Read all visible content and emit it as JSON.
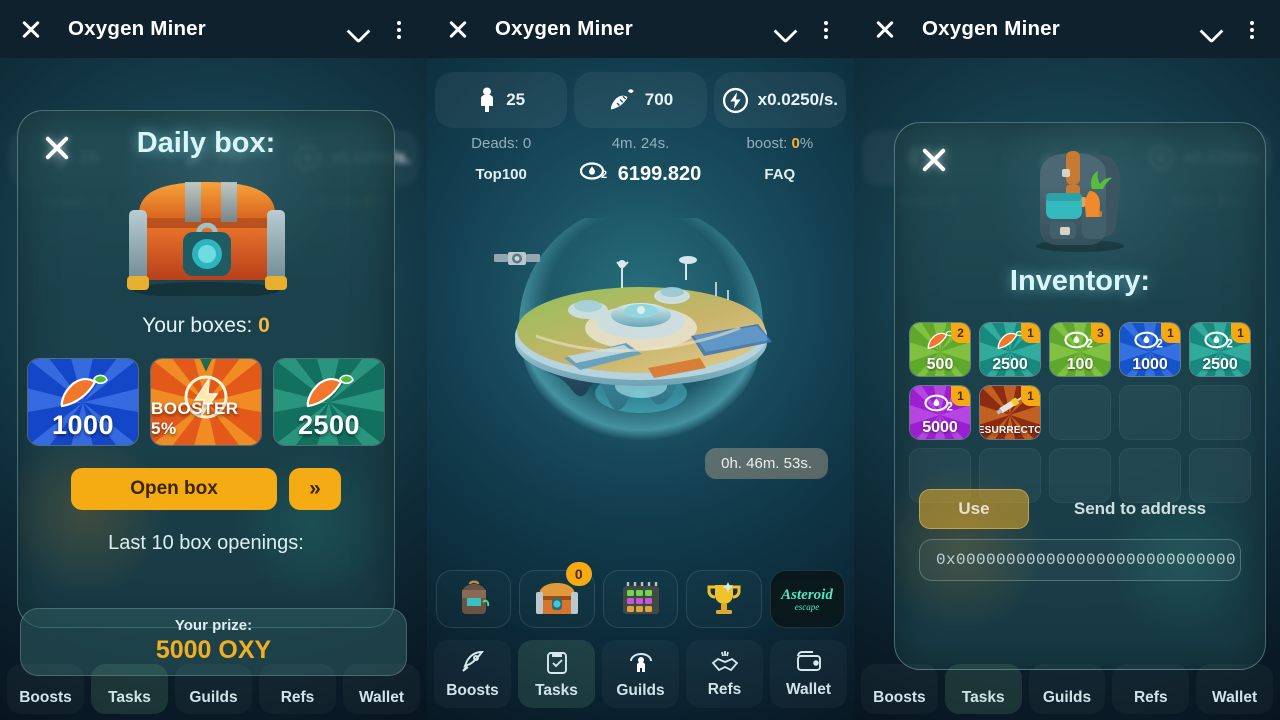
{
  "app": {
    "title": "Oxygen Miner",
    "accent_orange": "#f5ab14",
    "accent_cyan": "#d9f6fb"
  },
  "titlebar": {
    "close_icon": "close-icon",
    "chevron_icon": "chevron-down-icon",
    "menu_icon": "kebab-menu-icon"
  },
  "stats": {
    "population": "25",
    "carrots": "700",
    "rate": "x0.0250/s.",
    "deads_label": "Deads: 0",
    "timer": "4m. 24s.",
    "boost_label": "boost: ",
    "boost_value": "0",
    "boost_suffix": "%",
    "top100": "Top100",
    "oxygen": "6199.820",
    "faq": "FAQ"
  },
  "planet": {
    "timer_pill": "0h. 46m. 53s."
  },
  "icon_row": [
    {
      "name": "backpack-icon",
      "badge": ""
    },
    {
      "name": "treasure-chest-icon",
      "badge": "0"
    },
    {
      "name": "calendar-icon",
      "badge": ""
    },
    {
      "name": "trophy-icon",
      "badge": ""
    },
    {
      "name": "asteroid-escape-icon",
      "badge": "",
      "label": "Asteroid escape"
    }
  ],
  "bottom_nav": {
    "items": [
      {
        "label": "Boosts",
        "icon": "rocket-icon",
        "active": false
      },
      {
        "label": "Tasks",
        "icon": "clipboard-check-icon",
        "active": true
      },
      {
        "label": "Guilds",
        "icon": "guild-person-icon",
        "active": false
      },
      {
        "label": "Refs",
        "icon": "handshake-icon",
        "active": false
      },
      {
        "label": "Wallet",
        "icon": "wallet-icon",
        "active": false
      }
    ]
  },
  "daily_box_modal": {
    "title": "Daily box:",
    "close_icon": "close-icon",
    "chest_icon": "daily-box-chest-icon",
    "your_boxes_label": "Your boxes: ",
    "your_boxes_value": "0",
    "prizes": [
      {
        "value": "1000",
        "icon": "carrot-icon",
        "theme": "blue"
      },
      {
        "value": "BOOSTER 5%",
        "icon": "lightning-bolt-icon",
        "theme": "orange"
      },
      {
        "value": "2500",
        "icon": "carrot-icon",
        "theme": "teal"
      }
    ],
    "open_button": "Open box",
    "next_button": "»",
    "last_openings_label": "Last 10 box openings:",
    "prize_banner_label": "Your prize:",
    "prize_banner_value": "5000 OXY"
  },
  "inventory_modal": {
    "title": "Inventory:",
    "close_icon": "close-icon",
    "backpack_icon": "backpack-icon",
    "items": [
      {
        "value": "500",
        "qty": "2",
        "icon": "carrot-icon",
        "theme": "green"
      },
      {
        "value": "2500",
        "qty": "1",
        "icon": "carrot-icon",
        "theme": "teal"
      },
      {
        "value": "100",
        "qty": "3",
        "icon": "o2-icon",
        "theme": "green"
      },
      {
        "value": "1000",
        "qty": "1",
        "icon": "o2-icon",
        "theme": "blue"
      },
      {
        "value": "2500",
        "qty": "1",
        "icon": "o2-icon",
        "theme": "teal"
      },
      {
        "value": "5000",
        "qty": "1",
        "icon": "o2-icon",
        "theme": "purple"
      },
      {
        "value": "RESURRECTOR",
        "qty": "1",
        "icon": "syringe-icon",
        "theme": "fire"
      },
      {
        "value": "",
        "qty": "",
        "icon": "",
        "theme": "empty"
      },
      {
        "value": "",
        "qty": "",
        "icon": "",
        "theme": "empty"
      },
      {
        "value": "",
        "qty": "",
        "icon": "",
        "theme": "empty"
      },
      {
        "value": "",
        "qty": "",
        "icon": "",
        "theme": "empty"
      },
      {
        "value": "",
        "qty": "",
        "icon": "",
        "theme": "empty"
      },
      {
        "value": "",
        "qty": "",
        "icon": "",
        "theme": "empty"
      },
      {
        "value": "",
        "qty": "",
        "icon": "",
        "theme": "empty"
      },
      {
        "value": "",
        "qty": "",
        "icon": "",
        "theme": "empty"
      }
    ],
    "use_button": "Use",
    "send_label": "Send to address",
    "address_value": "0x0000000000000000000000000000"
  }
}
